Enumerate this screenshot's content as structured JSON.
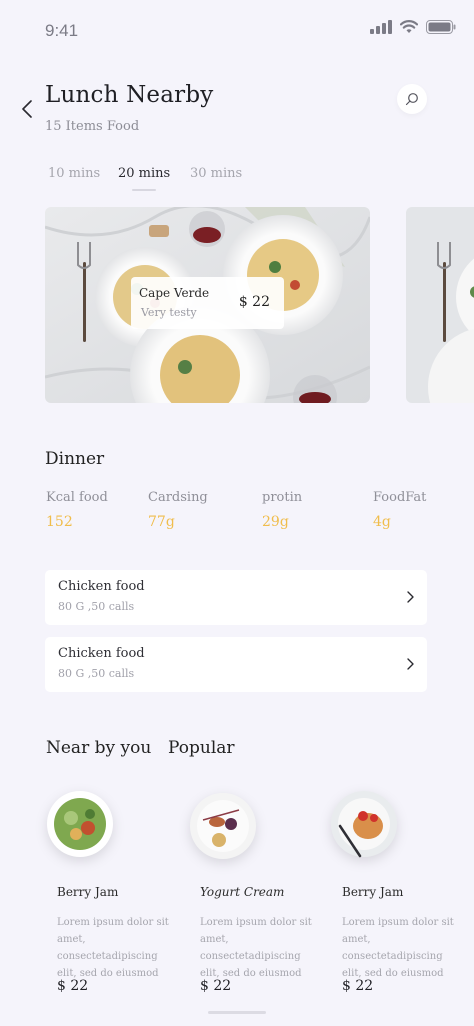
{
  "status_bar": {
    "time": "9:41"
  },
  "header": {
    "title": "Lunch Nearby",
    "subtitle": "15 Items Food"
  },
  "tabs": [
    {
      "label": "10 mins",
      "active": false
    },
    {
      "label": "20 mins",
      "active": true
    },
    {
      "label": "30 mins",
      "active": false
    }
  ],
  "featured": {
    "name": "Cape Verde",
    "description": "Very testy",
    "price": "$ 22"
  },
  "dinner": {
    "title": "Dinner",
    "stats": [
      {
        "label": "Kcal food",
        "value": "152"
      },
      {
        "label": "Cardsing",
        "value": "77g"
      },
      {
        "label": "protin",
        "value": "29g"
      },
      {
        "label": "FoodFat",
        "value": "4g"
      }
    ],
    "items": [
      {
        "name": "Chicken food",
        "meta": "80 G ,50 calls"
      },
      {
        "name": "Chicken food",
        "meta": "80 G ,50 calls"
      }
    ]
  },
  "sections": {
    "near_by": "Near by you",
    "popular": "Popular"
  },
  "nearby_items": [
    {
      "name": "Berry Jam",
      "description": "Lorem ipsum dolor sit amet, consectetadipiscing elit, sed do eiusmod",
      "price": "$ 22"
    },
    {
      "name": "Yogurt Cream",
      "description": "Lorem ipsum dolor sit amet, consectetadipiscing elit, sed do eiusmod",
      "price": "$ 22"
    },
    {
      "name": "Berry Jam",
      "description": "Lorem ipsum dolor sit amet, consectetadipiscing elit, sed do eiusmod",
      "price": "$ 22"
    }
  ],
  "colors": {
    "background": "#f5f4fb",
    "accent": "#f0bd4c",
    "card": "#ffffff"
  },
  "icons": [
    "signal-icon",
    "wifi-icon",
    "battery-icon",
    "back-arrow-icon",
    "search-icon",
    "chevron-right-icon"
  ]
}
